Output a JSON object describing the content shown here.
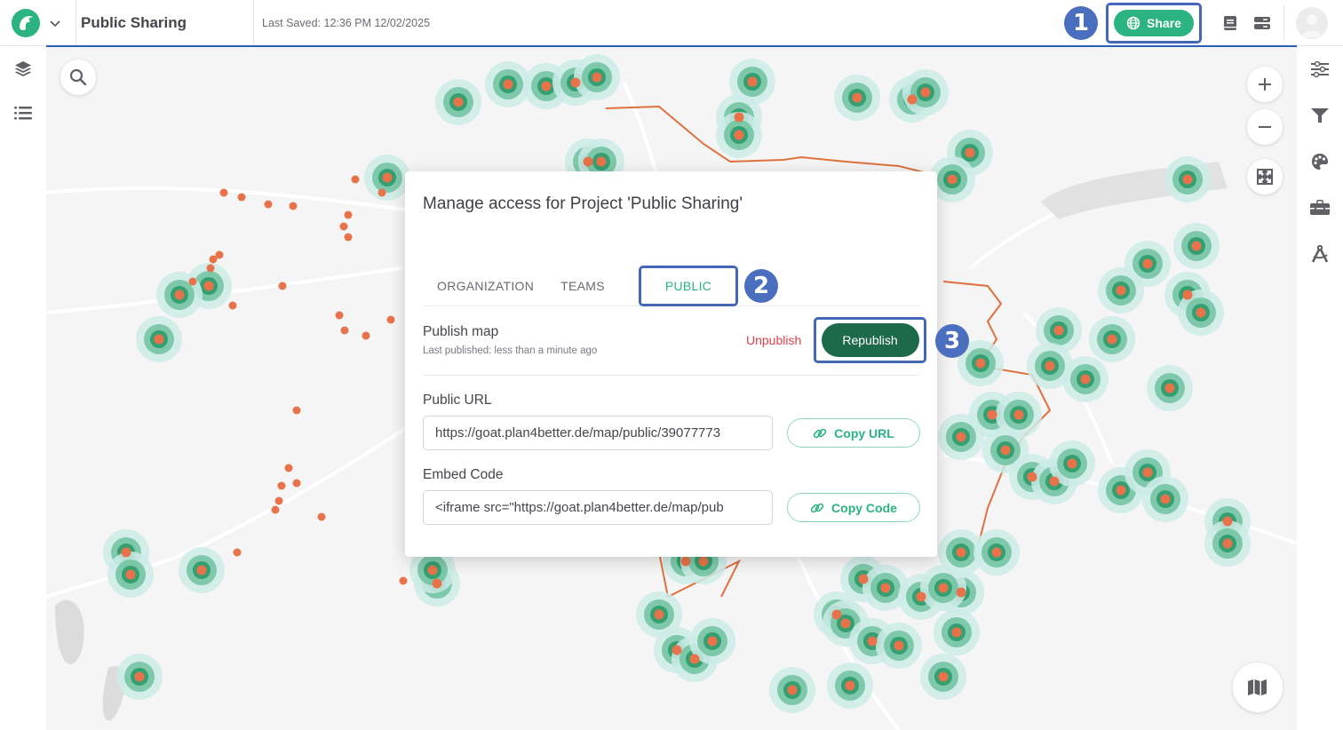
{
  "header": {
    "logo_icon": "goat-logo-icon",
    "project_title": "Public Sharing",
    "last_saved": "Last Saved: 12:36 PM 12/02/2025",
    "share_label": "Share",
    "badge_1": "1"
  },
  "left_sidebar": {
    "items": [
      {
        "icon": "layers-icon"
      },
      {
        "icon": "list-icon"
      }
    ]
  },
  "right_sidebar": {
    "items": [
      {
        "icon": "sliders-icon"
      },
      {
        "icon": "filter-icon"
      },
      {
        "icon": "palette-icon"
      },
      {
        "icon": "toolbox-icon"
      },
      {
        "icon": "compass-drafting-icon"
      }
    ]
  },
  "map_controls": {
    "search": "search-icon",
    "zoom_in": "plus-icon",
    "zoom_out": "minus-icon",
    "fullscreen": "expand-icon",
    "basemap": "map-icon"
  },
  "modal": {
    "title": "Manage access for Project 'Public Sharing'",
    "tabs": [
      {
        "label": "ORGANIZATION",
        "active": false
      },
      {
        "label": "TEAMS",
        "active": false
      },
      {
        "label": "PUBLIC",
        "active": true
      }
    ],
    "badge_2": "2",
    "publish": {
      "label": "Publish map",
      "sub": "Last published: less than a minute ago",
      "unpublish_label": "Unpublish",
      "republish_label": "Republish",
      "badge_3": "3"
    },
    "public_url": {
      "label": "Public URL",
      "value": "https://goat.plan4better.de/map/public/39077773",
      "copy_label": "Copy URL"
    },
    "embed_code": {
      "label": "Embed Code",
      "value": "<iframe src=\"https://goat.plan4better.de/map/pub",
      "copy_label": "Copy Code"
    }
  },
  "colors": {
    "brand_green": "#2bb381",
    "republish_green": "#1d6a4b",
    "unpublish_red": "#e0414f",
    "highlight_blue": "#4467b8",
    "point_orange": "#e8734a",
    "boundary_orange": "#e0703f"
  }
}
